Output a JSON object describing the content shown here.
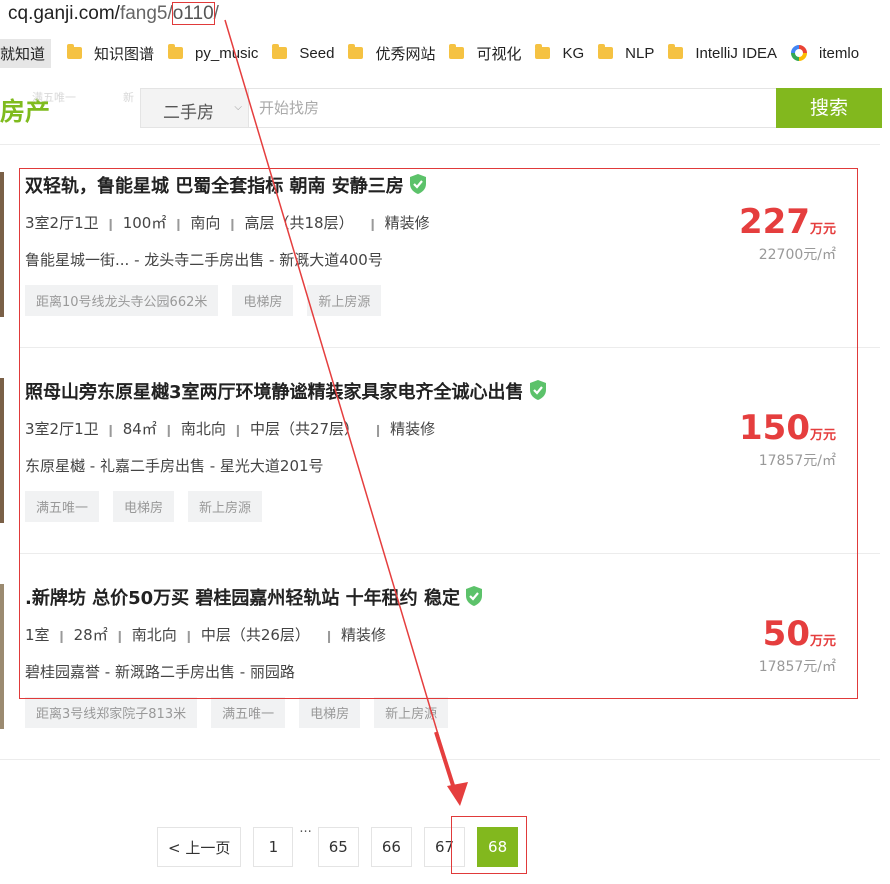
{
  "address_bar": {
    "domain": "cq.ganji.com/",
    "path": "fang5/",
    "boxed": "o110",
    "trailing": "/"
  },
  "bookmarks": [
    {
      "label": "就知道",
      "icon": "none"
    },
    {
      "label": "知识图谱",
      "icon": "folder-icon"
    },
    {
      "label": "py_music",
      "icon": "folder-icon"
    },
    {
      "label": "Seed",
      "icon": "folder-icon"
    },
    {
      "label": "优秀网站",
      "icon": "folder-icon"
    },
    {
      "label": "可视化",
      "icon": "folder-icon"
    },
    {
      "label": "KG",
      "icon": "folder-icon"
    },
    {
      "label": "NLP",
      "icon": "folder-icon"
    },
    {
      "label": "IntelliJ IDEA",
      "icon": "folder-icon"
    },
    {
      "label": "itemlo",
      "icon": "google-icon"
    }
  ],
  "header": {
    "logo": "房产",
    "faint_a": "满五唯一",
    "faint_b": "新",
    "search_type": "二手房",
    "search_placeholder": "开始找房",
    "search_button": "搜索"
  },
  "listings": [
    {
      "title": "双轻轨，鲁能星城 巴蜀全套指标 朝南 安静三房",
      "attrs": [
        "3室2厅1卫",
        "100㎡",
        "南向",
        "高层（共18层）",
        "精装修"
      ],
      "address": "鲁能星城一街... - 龙头寺二手房出售 - 新溉大道400号",
      "tags": [
        "距离10号线龙头寺公园662米",
        "电梯房",
        "新上房源"
      ],
      "price": "227",
      "price_unit": "万元",
      "unit_price": "22700元/㎡"
    },
    {
      "title": "照母山旁东原星樾3室两厅环境静谧精装家具家电齐全诚心出售",
      "attrs": [
        "3室2厅1卫",
        "84㎡",
        "南北向",
        "中层（共27层）",
        "精装修"
      ],
      "address": "东原星樾 - 礼嘉二手房出售 - 星光大道201号",
      "tags": [
        "满五唯一",
        "电梯房",
        "新上房源"
      ],
      "price": "150",
      "price_unit": "万元",
      "unit_price": "17857元/㎡"
    },
    {
      "title": ".新牌坊 总价50万买 碧桂园嘉州轻轨站 十年租约 稳定",
      "attrs": [
        "1室",
        "28㎡",
        "南北向",
        "中层（共26层）",
        "精装修"
      ],
      "address": "碧桂园嘉誉 - 新溉路二手房出售 - 丽园路",
      "tags": [
        "距离3号线郑家院子813米",
        "满五唯一",
        "电梯房",
        "新上房源"
      ],
      "price": "50",
      "price_unit": "万元",
      "unit_price": "17857元/㎡"
    }
  ],
  "pagination": {
    "prev": "< 上一页",
    "first": "1",
    "ellipsis": "...",
    "pages": [
      "65",
      "66",
      "67"
    ],
    "current": "68"
  },
  "colors": {
    "accent_green": "#82b81e",
    "price_red": "#e53e3e",
    "annotation_red": "#e03a3a"
  }
}
